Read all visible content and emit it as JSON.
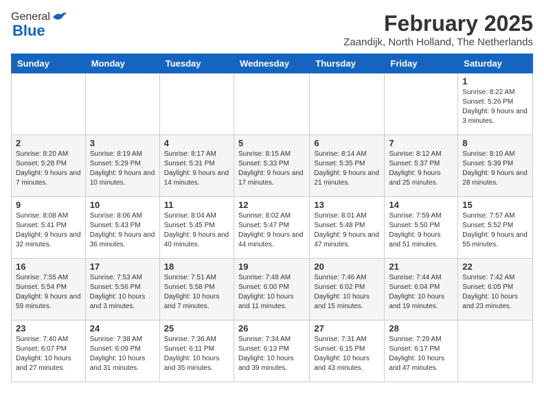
{
  "header": {
    "logo_general": "General",
    "logo_blue": "Blue",
    "title": "February 2025",
    "subtitle": "Zaandijk, North Holland, The Netherlands"
  },
  "weekdays": [
    "Sunday",
    "Monday",
    "Tuesday",
    "Wednesday",
    "Thursday",
    "Friday",
    "Saturday"
  ],
  "weeks": [
    [
      {
        "day": "",
        "info": ""
      },
      {
        "day": "",
        "info": ""
      },
      {
        "day": "",
        "info": ""
      },
      {
        "day": "",
        "info": ""
      },
      {
        "day": "",
        "info": ""
      },
      {
        "day": "",
        "info": ""
      },
      {
        "day": "1",
        "info": "Sunrise: 8:22 AM\nSunset: 5:26 PM\nDaylight: 9 hours and 3 minutes."
      }
    ],
    [
      {
        "day": "2",
        "info": "Sunrise: 8:20 AM\nSunset: 5:28 PM\nDaylight: 9 hours and 7 minutes."
      },
      {
        "day": "3",
        "info": "Sunrise: 8:19 AM\nSunset: 5:29 PM\nDaylight: 9 hours and 10 minutes."
      },
      {
        "day": "4",
        "info": "Sunrise: 8:17 AM\nSunset: 5:31 PM\nDaylight: 9 hours and 14 minutes."
      },
      {
        "day": "5",
        "info": "Sunrise: 8:15 AM\nSunset: 5:33 PM\nDaylight: 9 hours and 17 minutes."
      },
      {
        "day": "6",
        "info": "Sunrise: 8:14 AM\nSunset: 5:35 PM\nDaylight: 9 hours and 21 minutes."
      },
      {
        "day": "7",
        "info": "Sunrise: 8:12 AM\nSunset: 5:37 PM\nDaylight: 9 hours and 25 minutes."
      },
      {
        "day": "8",
        "info": "Sunrise: 8:10 AM\nSunset: 5:39 PM\nDaylight: 9 hours and 28 minutes."
      }
    ],
    [
      {
        "day": "9",
        "info": "Sunrise: 8:08 AM\nSunset: 5:41 PM\nDaylight: 9 hours and 32 minutes."
      },
      {
        "day": "10",
        "info": "Sunrise: 8:06 AM\nSunset: 5:43 PM\nDaylight: 9 hours and 36 minutes."
      },
      {
        "day": "11",
        "info": "Sunrise: 8:04 AM\nSunset: 5:45 PM\nDaylight: 9 hours and 40 minutes."
      },
      {
        "day": "12",
        "info": "Sunrise: 8:02 AM\nSunset: 5:47 PM\nDaylight: 9 hours and 44 minutes."
      },
      {
        "day": "13",
        "info": "Sunrise: 8:01 AM\nSunset: 5:48 PM\nDaylight: 9 hours and 47 minutes."
      },
      {
        "day": "14",
        "info": "Sunrise: 7:59 AM\nSunset: 5:50 PM\nDaylight: 9 hours and 51 minutes."
      },
      {
        "day": "15",
        "info": "Sunrise: 7:57 AM\nSunset: 5:52 PM\nDaylight: 9 hours and 55 minutes."
      }
    ],
    [
      {
        "day": "16",
        "info": "Sunrise: 7:55 AM\nSunset: 5:54 PM\nDaylight: 9 hours and 59 minutes."
      },
      {
        "day": "17",
        "info": "Sunrise: 7:53 AM\nSunset: 5:56 PM\nDaylight: 10 hours and 3 minutes."
      },
      {
        "day": "18",
        "info": "Sunrise: 7:51 AM\nSunset: 5:58 PM\nDaylight: 10 hours and 7 minutes."
      },
      {
        "day": "19",
        "info": "Sunrise: 7:48 AM\nSunset: 6:00 PM\nDaylight: 10 hours and 11 minutes."
      },
      {
        "day": "20",
        "info": "Sunrise: 7:46 AM\nSunset: 6:02 PM\nDaylight: 10 hours and 15 minutes."
      },
      {
        "day": "21",
        "info": "Sunrise: 7:44 AM\nSunset: 6:04 PM\nDaylight: 10 hours and 19 minutes."
      },
      {
        "day": "22",
        "info": "Sunrise: 7:42 AM\nSunset: 6:05 PM\nDaylight: 10 hours and 23 minutes."
      }
    ],
    [
      {
        "day": "23",
        "info": "Sunrise: 7:40 AM\nSunset: 6:07 PM\nDaylight: 10 hours and 27 minutes."
      },
      {
        "day": "24",
        "info": "Sunrise: 7:38 AM\nSunset: 6:09 PM\nDaylight: 10 hours and 31 minutes."
      },
      {
        "day": "25",
        "info": "Sunrise: 7:36 AM\nSunset: 6:11 PM\nDaylight: 10 hours and 35 minutes."
      },
      {
        "day": "26",
        "info": "Sunrise: 7:34 AM\nSunset: 6:13 PM\nDaylight: 10 hours and 39 minutes."
      },
      {
        "day": "27",
        "info": "Sunrise: 7:31 AM\nSunset: 6:15 PM\nDaylight: 10 hours and 43 minutes."
      },
      {
        "day": "28",
        "info": "Sunrise: 7:29 AM\nSunset: 6:17 PM\nDaylight: 10 hours and 47 minutes."
      },
      {
        "day": "",
        "info": ""
      }
    ]
  ]
}
